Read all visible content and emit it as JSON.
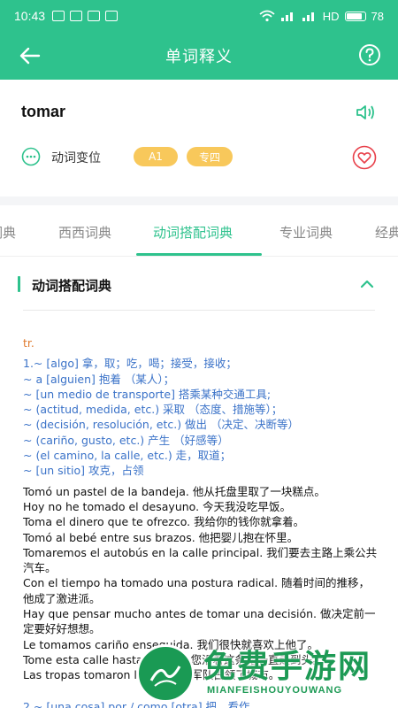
{
  "statusbar": {
    "time": "10:43",
    "network_label": "HD",
    "battery": "78"
  },
  "appbar": {
    "title": "单词释义"
  },
  "word": {
    "text": "tomar"
  },
  "conjugation": {
    "label": "动词变位"
  },
  "badges": {
    "level": "A1",
    "category": "专四"
  },
  "tabs": [
    "词典",
    "西西词典",
    "动词搭配词典",
    "专业词典",
    "经典"
  ],
  "section": {
    "title": "动词搭配词典"
  },
  "content": {
    "pos": "tr.",
    "meaning1": [
      "1.~ [algo] 拿，取；吃，喝；接受，接收；",
      "~ a [alguien] 抱着 （某人）；",
      "~ [un medio de transporte] 搭乘某种交通工具;",
      "~ (actitud, medida, etc.) 采取 （态度、措施等）；",
      "~ (decisión, resolución, etc.) 做出 （决定、决断等）",
      "~ (cariño, gusto, etc.) 产生 （好感等）",
      "~ (el camino, la calle, etc.) 走，取道；",
      "~ [un sitio] 攻克，占领"
    ],
    "examples": [
      "Tomó un pastel de la bandeja. 他从托盘里取了一块糕点。",
      "Hoy no he tomado el desayuno. 今天我没吃早饭。",
      "Toma el dinero que te ofrezco. 我给你的钱你就拿着。",
      "Tomó al bebé entre sus brazos. 他把婴儿抱在怀里。",
      "Tomaremos el autobús en la calle principal. 我们要去主路上乘公共汽车。",
      "Con el tiempo ha tomado una postura radical. 随着时间的推移，他成了激进派。",
      "Hay que pensar mucho antes de tomar una decisión. 做决定前一定要好好想想。",
      "Le tomamos cariño enseguida. 我们很快就喜欢上他了。",
      "Tome esta calle hasta el final. 您沿着这条路一直走到头。",
      "Las tropas tomaron la ciudad. 军队占领了城市。"
    ],
    "meaning2": "2.~ [una cosa] por / como [otra] 把…看作…"
  },
  "watermark": {
    "title": "免费手游网",
    "subtitle": "MIANFEISHOUYOUWANG"
  }
}
